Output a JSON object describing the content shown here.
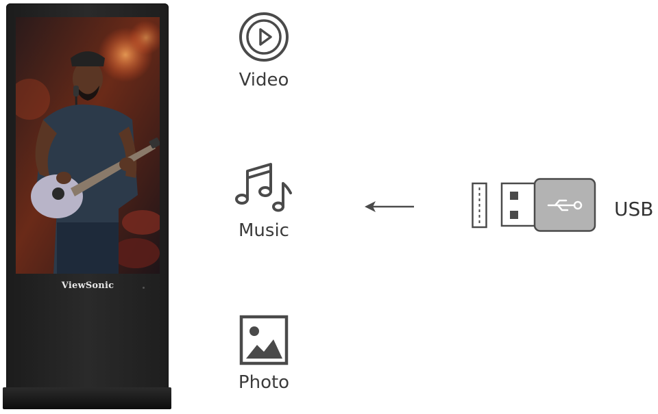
{
  "display": {
    "brand": "ViewSonic"
  },
  "media": {
    "video": {
      "label": "Video",
      "icon": "play-circle-icon"
    },
    "music": {
      "label": "Music",
      "icon": "music-notes-icon"
    },
    "photo": {
      "label": "Photo",
      "icon": "image-icon"
    }
  },
  "source": {
    "label": "USB",
    "icon": "usb-drive-icon",
    "arrow_icon": "arrow-left-icon"
  },
  "colors": {
    "icon_stroke": "#4a4a4a",
    "usb_body": "#b3b3b3",
    "text": "#3b3b3b"
  }
}
